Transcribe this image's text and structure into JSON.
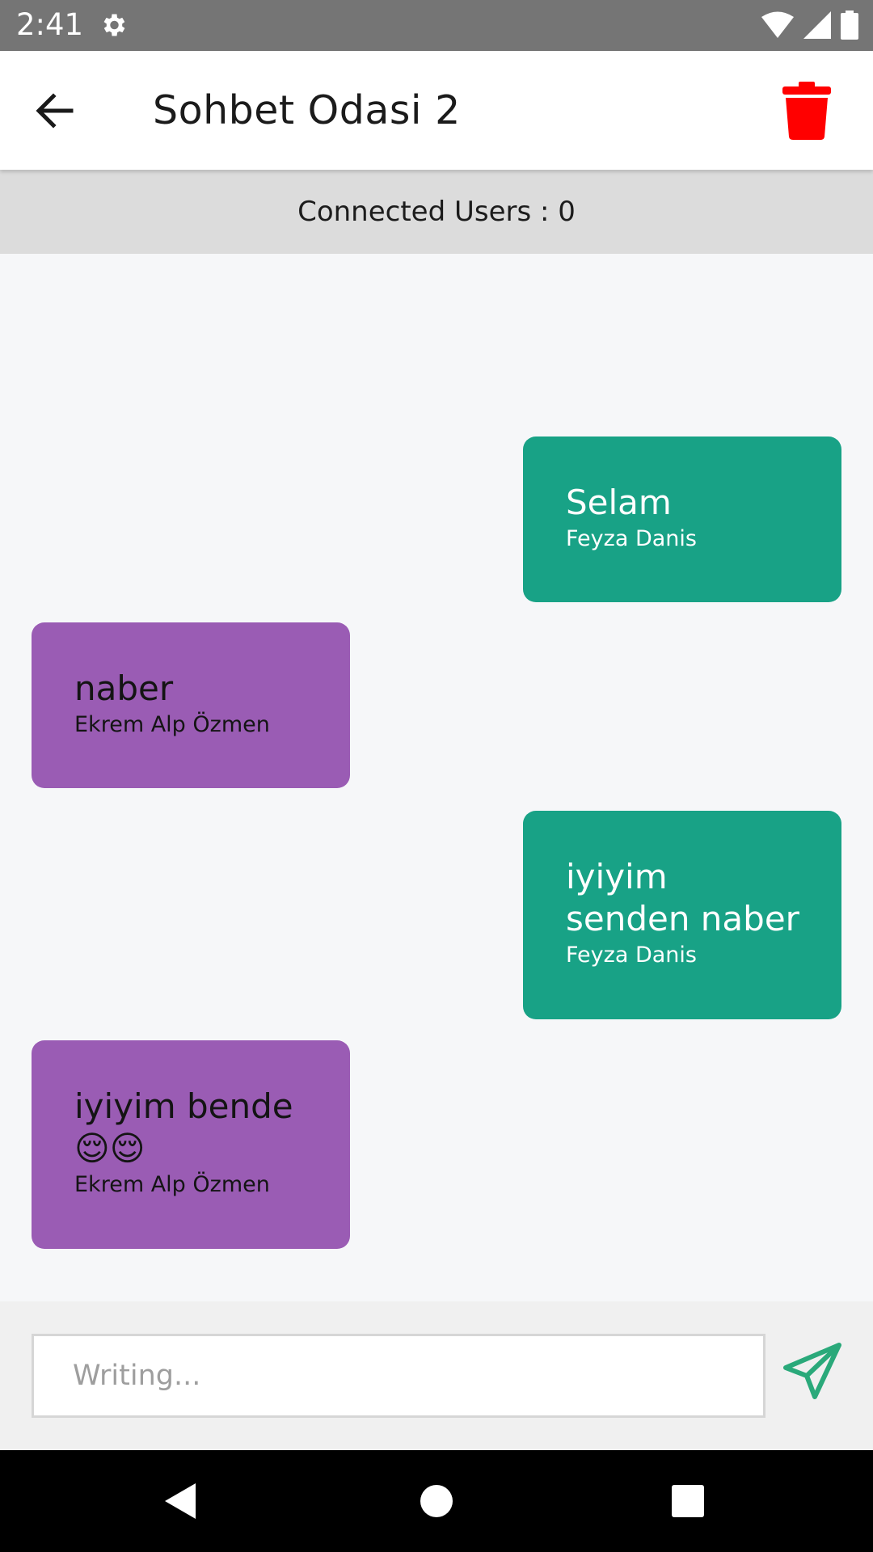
{
  "status_bar": {
    "time": "2:41",
    "icons": [
      "gear-icon",
      "wifi-icon",
      "signal-icon",
      "battery-icon"
    ]
  },
  "app_bar": {
    "title": "Sohbet Odasi 2",
    "back_icon": "arrow-left-icon",
    "delete_icon": "trash-icon",
    "delete_color": "#ff0000"
  },
  "connected": {
    "text": "Connected Users : 0"
  },
  "messages": [
    {
      "text": "Selam",
      "author": "Feyza Danis",
      "side": "sent"
    },
    {
      "text": "naber",
      "author": "Ekrem Alp Özmen",
      "side": "received"
    },
    {
      "text": "iyiyim senden naber",
      "author": "Feyza Danis",
      "side": "sent"
    },
    {
      "text": "iyiyim bende 😌😌",
      "author": "Ekrem Alp Özmen",
      "side": "received"
    }
  ],
  "colors": {
    "sent_bubble": "#18a286",
    "received_bubble": "#9a5cb4",
    "send_icon": "#2aa97a"
  },
  "composer": {
    "value": "",
    "placeholder": "Writing...",
    "send_icon": "paper-plane-icon"
  },
  "nav_bar": {
    "icons": [
      "back-triangle-icon",
      "home-circle-icon",
      "recents-square-icon"
    ]
  }
}
